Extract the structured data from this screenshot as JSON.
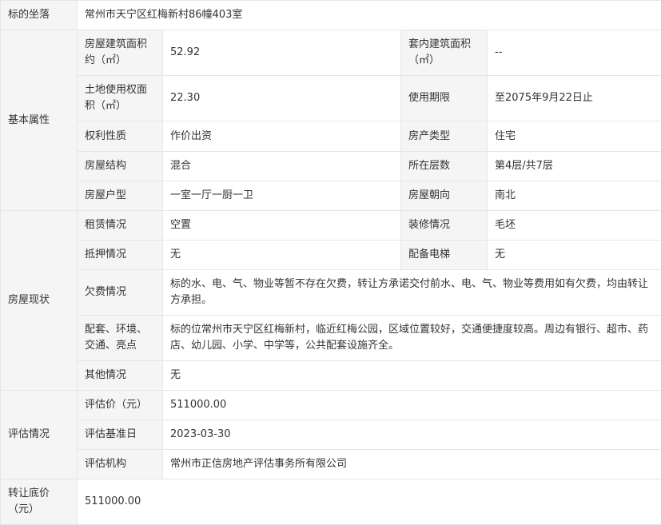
{
  "location": {
    "label": "标的坐落",
    "value": "常州市天宁区红梅新村86幢403室"
  },
  "basic": {
    "group_label": "基本属性",
    "building_area": {
      "label": "房屋建筑面积约（㎡）",
      "value": "52.92"
    },
    "inner_area": {
      "label": "套内建筑面积（㎡）",
      "value": "--"
    },
    "land_area": {
      "label": "土地使用权面积（㎡）",
      "value": "22.30"
    },
    "use_term": {
      "label": "使用期限",
      "value": "至2075年9月22日止"
    },
    "right_nature": {
      "label": "权利性质",
      "value": "作价出资"
    },
    "property_type": {
      "label": "房产类型",
      "value": "住宅"
    },
    "structure": {
      "label": "房屋结构",
      "value": "混合"
    },
    "floor": {
      "label": "所在层数",
      "value": "第4层/共7层"
    },
    "layout": {
      "label": "房屋户型",
      "value": "一室一厅一厨一卫"
    },
    "orientation": {
      "label": "房屋朝向",
      "value": "南北"
    }
  },
  "status": {
    "group_label": "房屋现状",
    "lease": {
      "label": "租赁情况",
      "value": "空置"
    },
    "decoration": {
      "label": "装修情况",
      "value": "毛坯"
    },
    "mortgage": {
      "label": "抵押情况",
      "value": "无"
    },
    "elevator": {
      "label": "配备电梯",
      "value": "无"
    },
    "arrears": {
      "label": "欠费情况",
      "value": "标的水、电、气、物业等暂不存在欠费，转让方承诺交付前水、电、气、物业等费用如有欠费，均由转让方承担。"
    },
    "facilities": {
      "label": "配套、环境、交通、亮点",
      "value": "标的位常州市天宁区红梅新村，临近红梅公园，区域位置较好，交通便捷度较高。周边有银行、超市、药店、幼儿园、小学、中学等，公共配套设施齐全。"
    },
    "other": {
      "label": "其他情况",
      "value": "无"
    }
  },
  "evaluation": {
    "group_label": "评估情况",
    "price": {
      "label": "评估价（元）",
      "value": "511000.00"
    },
    "base_date": {
      "label": "评估基准日",
      "value": "2023-03-30"
    },
    "agency": {
      "label": "评估机构",
      "value": "常州市正信房地产评估事务所有限公司"
    }
  },
  "reserve_price": {
    "label": "转让底价（元）",
    "value": "511000.00"
  }
}
